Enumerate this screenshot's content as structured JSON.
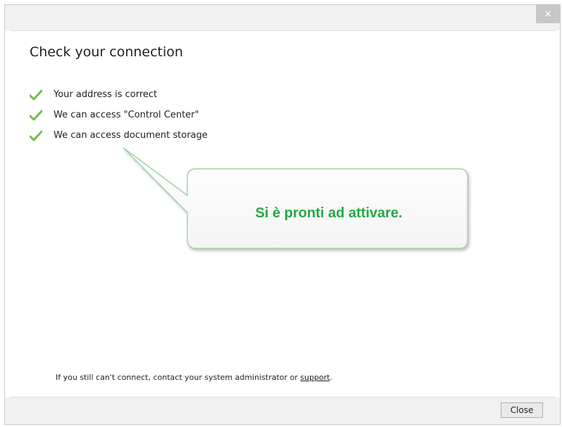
{
  "window": {
    "close_glyph": "×"
  },
  "dialog": {
    "heading": "Check your connection",
    "checks": [
      {
        "label": "Your address is correct",
        "icon": "check-icon",
        "status": "ok"
      },
      {
        "label": "We can access \"Control Center\"",
        "icon": "check-icon",
        "status": "ok"
      },
      {
        "label": "We can access document storage",
        "icon": "check-icon",
        "status": "ok"
      }
    ],
    "footer_prefix": "If you still can't connect, contact your system administrator or ",
    "footer_link": "support",
    "footer_suffix": ".",
    "close_button_label": "Close"
  },
  "callout": {
    "text": "Si è pronti ad attivare.",
    "text_color": "#28a745",
    "border_color": "#8fcf9b"
  },
  "colors": {
    "check_green": "#6bc04b"
  }
}
